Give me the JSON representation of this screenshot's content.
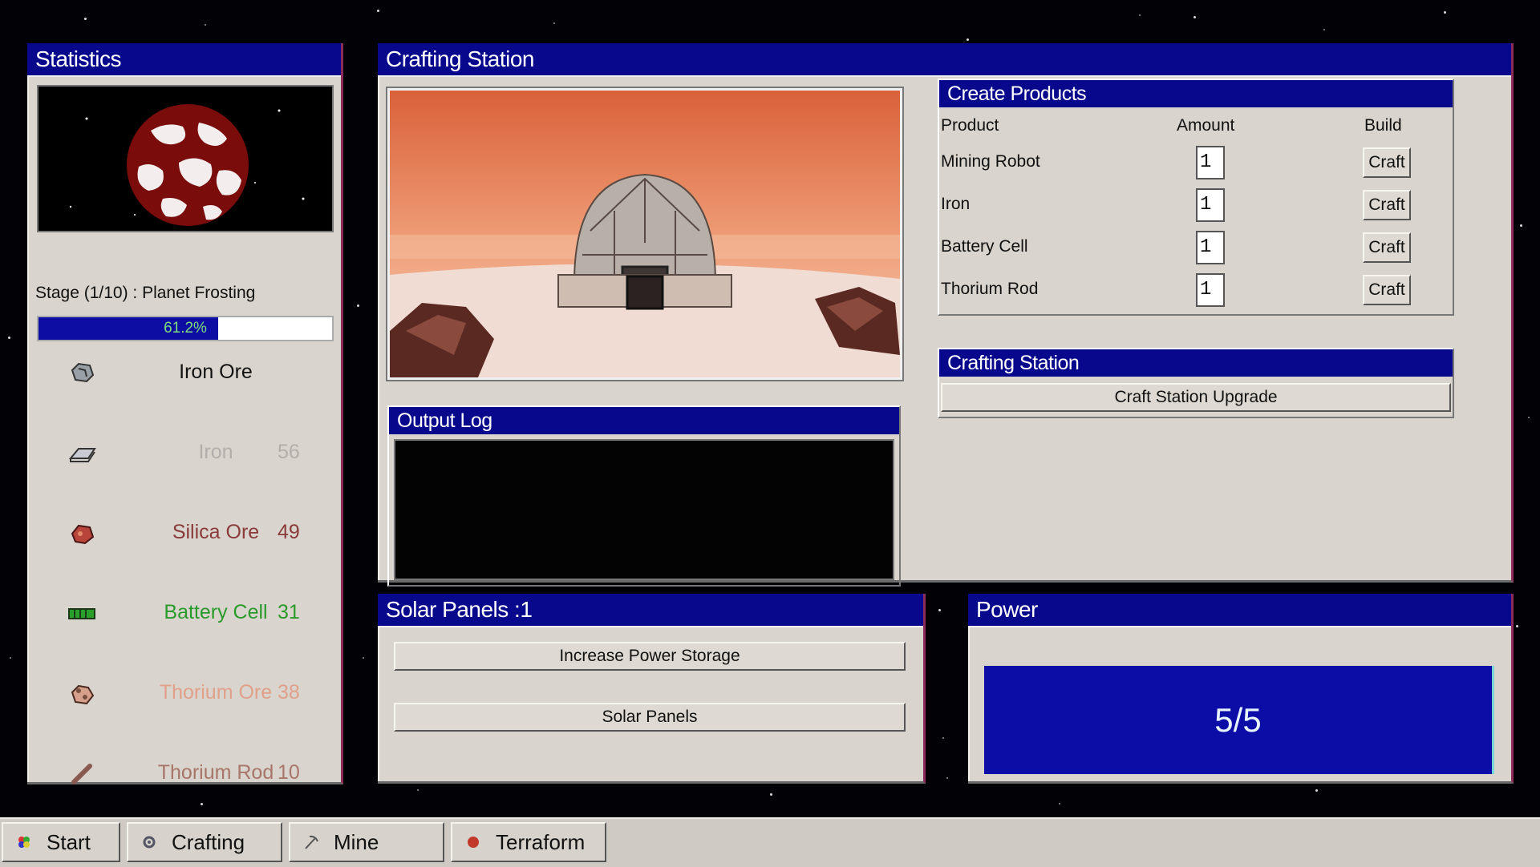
{
  "statistics": {
    "title": "Statistics",
    "stage": "Stage (1/10) : Planet Frosting",
    "progress": 0.612,
    "progress_label": "61.2%",
    "resources": [
      {
        "name": "Iron Ore",
        "count": "",
        "icon": "iron-ore-icon",
        "color": "#111111"
      },
      {
        "name": "Iron",
        "count": "56",
        "icon": "iron-ingot-icon",
        "color": "#b3aeab"
      },
      {
        "name": "Silica Ore",
        "count": "49",
        "icon": "silica-ore-icon",
        "color": "#8a3a3a"
      },
      {
        "name": "Battery Cell",
        "count": "31",
        "icon": "battery-cell-icon",
        "color": "#2a9a2a"
      },
      {
        "name": "Thorium Ore",
        "count": "38",
        "icon": "thorium-ore-icon",
        "color": "#e0a08a"
      },
      {
        "name": "Thorium Rod",
        "count": "10",
        "icon": "thorium-rod-icon",
        "color": "#a8756a"
      }
    ]
  },
  "crafting_station": {
    "title": "Crafting Station",
    "output_log": {
      "title": "Output Log"
    },
    "create_products": {
      "title": "Create Products",
      "headers": {
        "product": "Product",
        "amount": "Amount",
        "build": "Build"
      },
      "rows": [
        {
          "product": "Mining Robot",
          "amount": "1",
          "build": "Craft"
        },
        {
          "product": "Iron",
          "amount": "1",
          "build": "Craft"
        },
        {
          "product": "Battery Cell",
          "amount": "1",
          "build": "Craft"
        },
        {
          "product": "Thorium Rod",
          "amount": "1",
          "build": "Craft"
        }
      ]
    },
    "upgrade_panel": {
      "title": "Crafting Station",
      "button": "Craft Station Upgrade"
    }
  },
  "solar_panels": {
    "title": "Solar Panels :1",
    "increase_button": "Increase Power Storage",
    "solar_button": "Solar Panels"
  },
  "power": {
    "title": "Power",
    "value": "5/5"
  },
  "taskbar": [
    {
      "label": "Start",
      "icon": "start-icon"
    },
    {
      "label": "Crafting",
      "icon": "crafting-icon"
    },
    {
      "label": "Mine",
      "icon": "pickaxe-icon"
    },
    {
      "label": "Terraform",
      "icon": "terraform-icon"
    }
  ],
  "colors": {
    "titlebar": "#08088c",
    "panel": "#d9d4cd",
    "progress_fill": "#0d0da3",
    "progress_text": "#7fdc7f",
    "power_fill": "#0c0ca6",
    "space": "#020206"
  }
}
